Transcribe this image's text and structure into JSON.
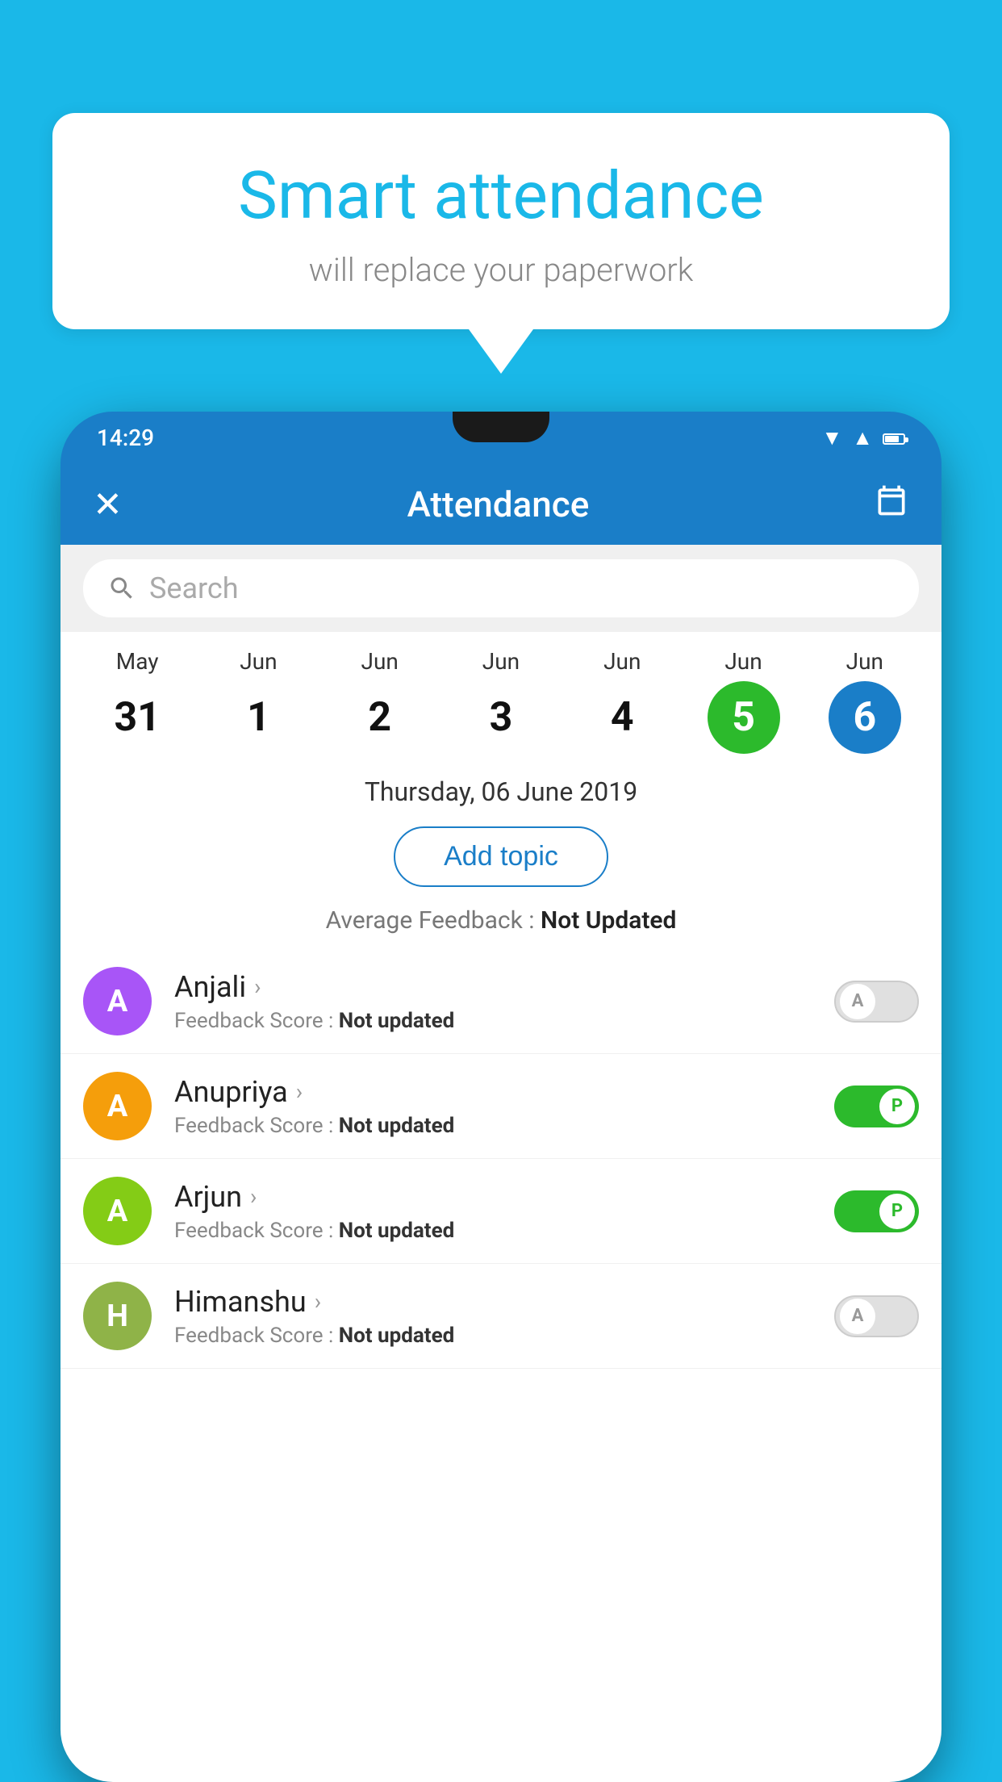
{
  "background_color": "#1ab8e8",
  "speech_bubble": {
    "heading": "Smart attendance",
    "subtext": "will replace your paperwork"
  },
  "app": {
    "status_bar": {
      "time": "14:29"
    },
    "app_bar": {
      "title": "Attendance",
      "close_icon": "✕",
      "calendar_icon": "📅"
    },
    "search": {
      "placeholder": "Search"
    },
    "calendar": {
      "dates": [
        {
          "month": "May",
          "day": "31",
          "state": "normal"
        },
        {
          "month": "Jun",
          "day": "1",
          "state": "normal"
        },
        {
          "month": "Jun",
          "day": "2",
          "state": "normal"
        },
        {
          "month": "Jun",
          "day": "3",
          "state": "normal"
        },
        {
          "month": "Jun",
          "day": "4",
          "state": "normal"
        },
        {
          "month": "Jun",
          "day": "5",
          "state": "today"
        },
        {
          "month": "Jun",
          "day": "6",
          "state": "selected"
        }
      ]
    },
    "selected_date": "Thursday, 06 June 2019",
    "add_topic_label": "Add topic",
    "average_feedback_label": "Average Feedback :",
    "average_feedback_value": "Not Updated",
    "students": [
      {
        "name": "Anjali",
        "initial": "A",
        "avatar_color": "purple",
        "feedback_label": "Feedback Score :",
        "feedback_value": "Not updated",
        "toggle_state": "off",
        "toggle_letter": "A"
      },
      {
        "name": "Anupriya",
        "initial": "A",
        "avatar_color": "yellow",
        "feedback_label": "Feedback Score :",
        "feedback_value": "Not updated",
        "toggle_state": "on",
        "toggle_letter": "P"
      },
      {
        "name": "Arjun",
        "initial": "A",
        "avatar_color": "green",
        "feedback_label": "Feedback Score :",
        "feedback_value": "Not updated",
        "toggle_state": "on",
        "toggle_letter": "P"
      },
      {
        "name": "Himanshu",
        "initial": "H",
        "avatar_color": "olive",
        "feedback_label": "Feedback Score :",
        "feedback_value": "Not updated",
        "toggle_state": "off",
        "toggle_letter": "A"
      }
    ]
  }
}
